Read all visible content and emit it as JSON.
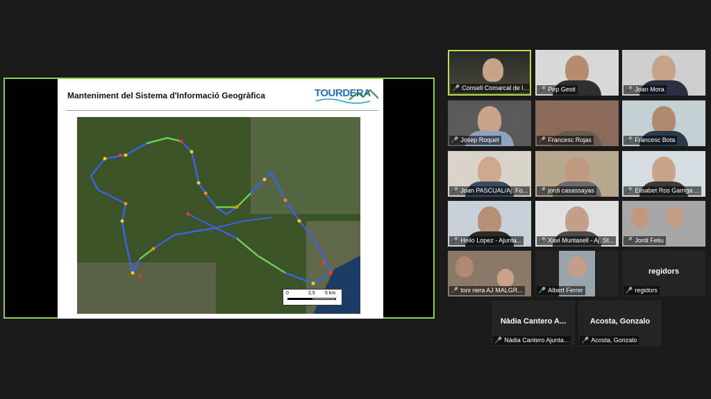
{
  "slide": {
    "title": "Manteniment del Sistema d'Informació Geogràfica",
    "logo_text": "TOURDERA",
    "scale_labels": [
      "0",
      "2,5",
      "5 km"
    ]
  },
  "participants": [
    {
      "name": "Consell Comarcal de la ...",
      "video": true,
      "active": true,
      "photo": true
    },
    {
      "name": "Pep Gesti",
      "video": true
    },
    {
      "name": "Joan Mora",
      "video": true
    },
    {
      "name": "Josep Roquet",
      "video": true
    },
    {
      "name": "Francesc Rojas",
      "video": true
    },
    {
      "name": "Francesc Bota",
      "video": true
    },
    {
      "name": "Joan PASCUAL/Aj. Fo...",
      "video": true
    },
    {
      "name": "jordi casassayas",
      "video": true
    },
    {
      "name": "Elisabet Ros Garriga ...",
      "video": true
    },
    {
      "name": "Helio Lopez - Ajunta...",
      "video": true
    },
    {
      "name": "Xavi Muntasell - Aj. St...",
      "video": true
    },
    {
      "name": "Jordi Feliu",
      "video": true
    },
    {
      "name": "toni riera  AJ MALGR...",
      "video": true
    },
    {
      "name": "Albert Ferrer",
      "video": true
    },
    {
      "name": "regidors",
      "video": false,
      "display": "regidors"
    },
    {
      "name": "Nàdia Cantero Ajunta...",
      "video": false,
      "display": "Nàdia Cantero A..."
    },
    {
      "name": "Acosta, Gonzalo",
      "video": false,
      "display": "Acosta, Gonzalo"
    }
  ],
  "colors": {
    "active_border": "#b8e04a",
    "share_border": "#8fd14f",
    "mic_muted": "#e53935",
    "logo": "#1e6fb7"
  }
}
